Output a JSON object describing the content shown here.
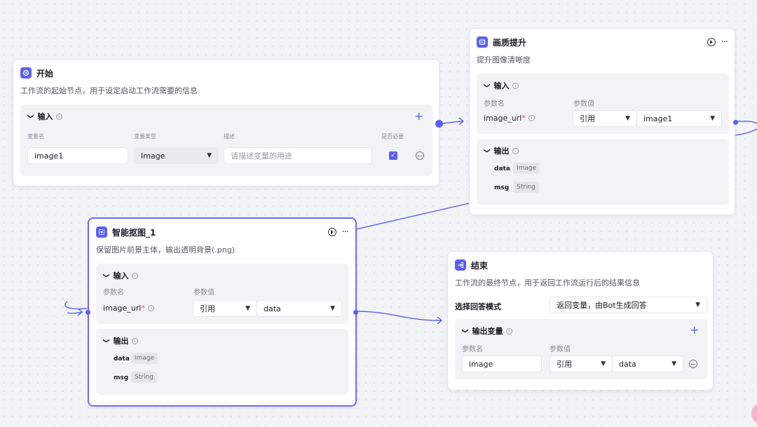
{
  "start_node": {
    "title": "开始",
    "icon": "start-icon",
    "description": "工作流的起始节点，用于设定启动工作流需要的信息",
    "input": {
      "label": "输入",
      "col_var_name": "变量名",
      "col_var_type": "变量类型",
      "col_desc": "描述",
      "col_required": "是否必要",
      "var_name": "image1",
      "var_type": "Image",
      "desc_placeholder": "请描述变量的用途",
      "required": true
    }
  },
  "enhance_node": {
    "title": "画质提升",
    "icon": "enhance-icon",
    "description": "提升图像清晰度",
    "input": {
      "label": "输入",
      "col_param_name": "参数名",
      "col_param_value": "参数值",
      "param_name": "image_url",
      "required_mark": "*",
      "ref_type": "引用",
      "ref_value": "image1"
    },
    "output": {
      "label": "输出",
      "items": [
        {
          "name": "data",
          "type": "Image"
        },
        {
          "name": "msg",
          "type": "String"
        }
      ]
    }
  },
  "cutout_node": {
    "title": "智能抠图_1",
    "icon": "cutout-icon",
    "description": "保留图片前景主体，输出透明背景(.png)",
    "input": {
      "label": "输入",
      "col_param_name": "参数名",
      "col_param_value": "参数值",
      "param_name": "image_url",
      "required_mark": "*",
      "ref_type": "引用",
      "ref_value": "data"
    },
    "output": {
      "label": "输出",
      "items": [
        {
          "name": "data",
          "type": "Image"
        },
        {
          "name": "msg",
          "type": "String"
        }
      ]
    }
  },
  "end_node": {
    "title": "结束",
    "icon": "end-icon",
    "description": "工作流的最终节点，用于返回工作流运行后的结果信息",
    "answer_mode_label": "选择回答模式",
    "answer_mode_value": "返回变量，由Bot生成回答",
    "output_vars": {
      "label": "输出变量",
      "col_param_name": "参数名",
      "col_param_value": "参数值",
      "var_name": "image",
      "ref_type": "引用",
      "ref_value": "data"
    }
  },
  "colors": {
    "accent": "#5b5ef0",
    "canvas_bg": "#f2f3f6",
    "required": "#e5484d"
  }
}
